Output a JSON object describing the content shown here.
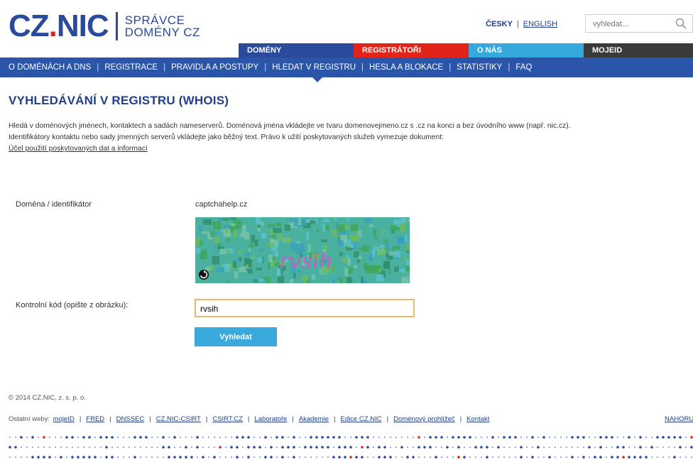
{
  "header": {
    "logo_mark": "CZ.NIC",
    "logo_line1": "SPRÁVCE",
    "logo_line2": "DOMÉNY CZ",
    "lang_cs": "ČESKY",
    "lang_sep": "|",
    "lang_en": "ENGLISH",
    "search_placeholder": "vyhledat..."
  },
  "top_tabs": [
    {
      "label": "DOMÉNY",
      "color": "#2a4b9b"
    },
    {
      "label": "REGISTRÁTOŘI",
      "color": "#e2231a"
    },
    {
      "label": "O NÁS",
      "color": "#35a9dc"
    },
    {
      "label": "MOJEID",
      "color": "#3a3a3a"
    }
  ],
  "nav": {
    "items": [
      "O DOMÉNÁCH A DNS",
      "REGISTRACE",
      "PRAVIDLA A POSTUPY",
      "HLEDAT V REGISTRU",
      "HESLA A BLOKACE",
      "STATISTIKY",
      "FAQ"
    ],
    "active": "HLEDAT V REGISTRU"
  },
  "page": {
    "title": "VYHLEDÁVÁNÍ V REGISTRU (WHOIS)",
    "intro_line1": "Hledá v doménových jménech, kontaktech a sadách nameserverů. Doménová jména vkládejte ve tvaru domenovejmeno.cz s .cz na konci a bez úvodního www (např. nic.cz).",
    "intro_line2": "Identifikátory kontaktu nebo sady jmenných serverů vkládejte jako běžný text. Právo k užití poskytovaných služeb vymezuje dokument:",
    "intro_link": "Účel použití poskytovaných dat a informací"
  },
  "form": {
    "domain_label": "Doména / identifikátor",
    "domain_value": "captchahelp.cz",
    "captcha_text": "rvsih",
    "code_label": "Kontrolní kód (opište z obrázku):",
    "code_value": "rvsih",
    "submit_label": "Vyhledat",
    "accent": "#3aa9dc"
  },
  "footer": {
    "copyright": "© 2014 CZ.NIC, z. s. p. o.",
    "other_sites_label": "Ostatní weby:",
    "links": [
      "mojeID",
      "FRED",
      "DNSSEC",
      "CZ.NIC-CSIRT",
      "CSIRT.CZ",
      "Laboratoře",
      "Akademie",
      "Edice CZ.NIC",
      "Doménový prohlížeč",
      "Kontakt"
    ],
    "top_link": "NAHORU"
  }
}
